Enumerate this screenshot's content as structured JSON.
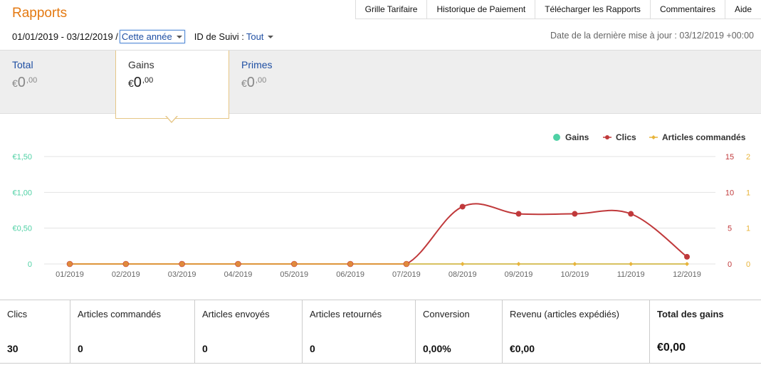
{
  "header": {
    "title": "Rapports",
    "nav": [
      "Grille Tarifaire",
      "Historique de Paiement",
      "Télécharger les Rapports",
      "Commentaires",
      "Aide"
    ]
  },
  "filters": {
    "date_range": "01/01/2019 - 03/12/2019 /",
    "period": "Cette année",
    "tracking_label": "ID de Suivi :",
    "tracking_value": "Tout"
  },
  "last_update": "Date de la dernière mise à jour : 03/12/2019 +00:00",
  "summary": {
    "cards": [
      {
        "label": "Total",
        "currency": "€",
        "int": "0",
        "dec": ",00"
      },
      {
        "label": "Gains",
        "currency": "€",
        "int": "0",
        "dec": ",00"
      },
      {
        "label": "Primes",
        "currency": "€",
        "int": "0",
        "dec": ",00"
      }
    ]
  },
  "colors": {
    "accent": "#e47911",
    "link": "#1f4fa3",
    "gains": "#4fd1a5",
    "clics": "#c0393b",
    "articles": "#e8b43a"
  },
  "chart_data": {
    "type": "line",
    "legend_position": "top-right",
    "categories": [
      "01/2019",
      "02/2019",
      "03/2019",
      "04/2019",
      "05/2019",
      "06/2019",
      "07/2019",
      "08/2019",
      "09/2019",
      "10/2019",
      "11/2019",
      "12/2019"
    ],
    "axes": {
      "left": {
        "ticks": [
          "€1,50",
          "€1,00",
          "€0,50",
          "0"
        ],
        "range": [
          0,
          1.5
        ]
      },
      "right1": {
        "ticks": [
          "15",
          "10",
          "5",
          "0"
        ],
        "range": [
          0,
          15
        ]
      },
      "right2": {
        "ticks": [
          "2",
          "1",
          "1",
          "0"
        ],
        "range": [
          0,
          2
        ]
      }
    },
    "series": [
      {
        "name": "Gains",
        "axis": "left",
        "values": [
          0,
          0,
          0,
          0,
          0,
          0,
          0,
          0,
          0,
          0,
          0,
          0
        ]
      },
      {
        "name": "Clics",
        "axis": "right1",
        "values": [
          0,
          0,
          0,
          0,
          0,
          0,
          0,
          8,
          7,
          7,
          7,
          1
        ]
      },
      {
        "name": "Articles commandés",
        "axis": "right2",
        "values": [
          0,
          0,
          0,
          0,
          0,
          0,
          0,
          0,
          0,
          0,
          0,
          0
        ]
      }
    ],
    "grid": true
  },
  "stats": [
    {
      "label": "Clics",
      "value": "30"
    },
    {
      "label": "Articles commandés",
      "value": "0"
    },
    {
      "label": "Articles envoyés",
      "value": "0"
    },
    {
      "label": "Articles retournés",
      "value": "0"
    },
    {
      "label": "Conversion",
      "value": "0,00%"
    },
    {
      "label": "Revenu (articles expédiés)",
      "value": "€0,00"
    },
    {
      "label": "Total des gains",
      "value": "€0,00"
    }
  ]
}
